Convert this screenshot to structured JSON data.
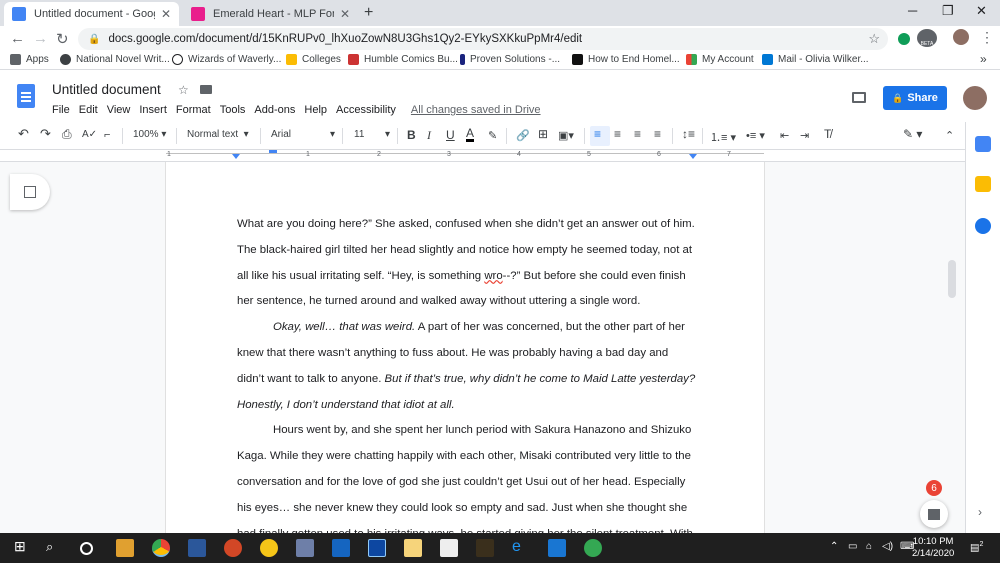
{
  "browser": {
    "tabs": [
      {
        "title": "Untitled document - Google Doc",
        "icon": "docs-icon",
        "color": "#4285f4"
      },
      {
        "title": "Emerald Heart - MLP Forums",
        "icon": "mlp-forums-icon",
        "color": "#e91e8c"
      }
    ],
    "new_tab": "+",
    "url": "docs.google.com/document/d/15KnRUPv0_lhXuoZowN8U3Ghs1Qy2-EYkySXKkuPpMr4/edit",
    "beta_label": "BETA",
    "bookmarks": [
      {
        "label": "Apps",
        "color": "#5f6368"
      },
      {
        "label": "National Novel Writ...",
        "color": "#3c4043"
      },
      {
        "label": "Wizards of Waverly...",
        "color": "#202124"
      },
      {
        "label": "Colleges",
        "color": "#fbbc04"
      },
      {
        "label": "Humble Comics Bu...",
        "color": "#cc3333"
      },
      {
        "label": "Proven Solutions -...",
        "color": "#1a237e"
      },
      {
        "label": "How to End Homel...",
        "color": "#111111"
      },
      {
        "label": "My Account",
        "color": "#ea4335"
      },
      {
        "label": "Mail - Olivia Wilker...",
        "color": "#0078d4"
      }
    ],
    "more_bookmarks": "»"
  },
  "docs": {
    "title": "Untitled document",
    "menu": [
      "File",
      "Edit",
      "View",
      "Insert",
      "Format",
      "Tools",
      "Add-ons",
      "Help",
      "Accessibility"
    ],
    "saved_status": "All changes saved in Drive",
    "share_label": "Share",
    "toolbar": {
      "zoom": "100%",
      "style": "Normal text",
      "font": "Arial",
      "size": "11"
    },
    "ruler_numbers": [
      "1",
      "1",
      "2",
      "3",
      "4",
      "5",
      "6",
      "7"
    ]
  },
  "document": {
    "paragraphs": [
      {
        "indent": false,
        "runs": [
          {
            "text": "What are you doing here?” She asked, confused when she didn’t get an answer out of him. The black-haired girl tilted her head slightly and notice how empty he seemed today, not at all like his usual irritating self. “Hey, is something "
          },
          {
            "text": "wro",
            "squiggle": true
          },
          {
            "text": "--?” But before she could even finish her sentence, he turned around and walked away without uttering a single word."
          }
        ]
      },
      {
        "indent": true,
        "runs": [
          {
            "text": "Okay, well… that was weird.",
            "italic": true
          },
          {
            "text": " A part of her was concerned, but the other part of her knew that there wasn’t anything to fuss about. He was probably having a bad day and didn’t want to talk to anyone. "
          },
          {
            "text": "But if that’s true, why didn’t he come to Maid Latte yesterday? Honestly, I don’t understand that idiot at all.",
            "italic": true
          }
        ]
      },
      {
        "indent": true,
        "runs": [
          {
            "text": "Hours went by, and she spent her lunch period with Sakura Hanazono and Shizuko Kaga. While they were chatting happily with each other, Misaki contributed very little to the conversation and for the love of god she just couldn’t get Usui out of her head. Especially his eyes… she never knew they could look so empty and sad. Just when she thought she had finally gotten used to his irritating ways, he started giving her the silent treatment. With no"
          }
        ]
      }
    ]
  },
  "notifications": {
    "badge": "6"
  },
  "taskbar": {
    "clock_time": "10:10 PM",
    "clock_date": "2/14/2020",
    "notification_count": "2"
  }
}
